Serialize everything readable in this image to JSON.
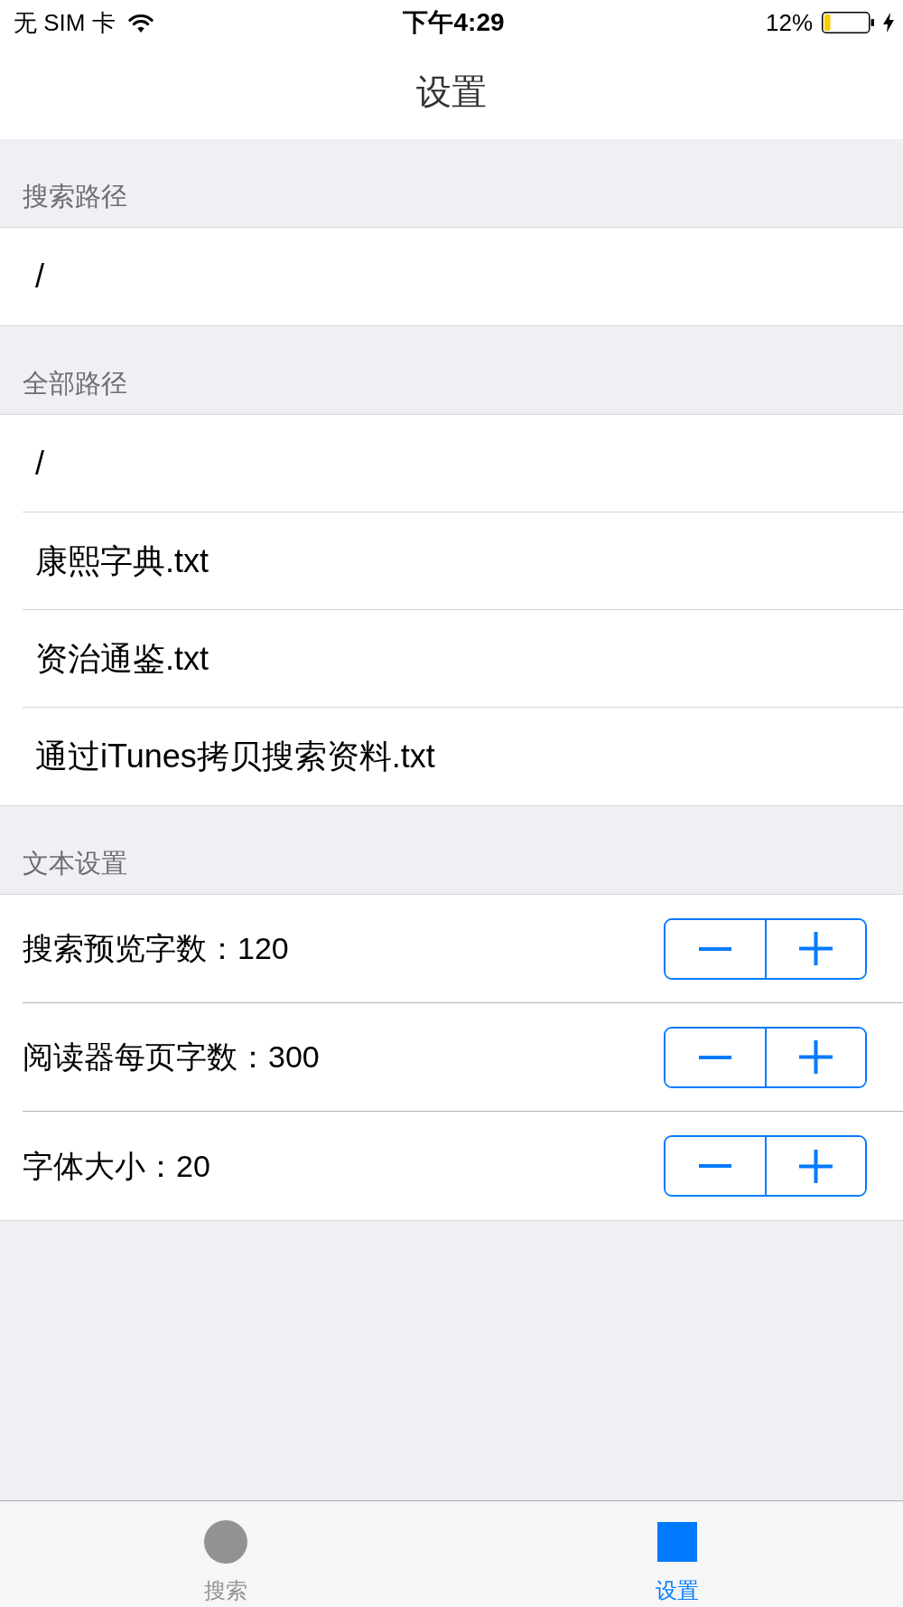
{
  "status_bar": {
    "carrier": "无 SIM 卡",
    "time": "下午4:29",
    "battery": "12%"
  },
  "nav_bar": {
    "title": "设置"
  },
  "sections": [
    {
      "header": "搜索路径",
      "rows": [
        {
          "kind": "path",
          "label": "/"
        }
      ]
    },
    {
      "header": "全部路径",
      "rows": [
        {
          "kind": "path",
          "label": "/"
        },
        {
          "kind": "path",
          "label": "康熙字典.txt"
        },
        {
          "kind": "path",
          "label": "资治通鉴.txt"
        },
        {
          "kind": "path",
          "label": "通过iTunes拷贝搜索资料.txt"
        }
      ]
    },
    {
      "header": "文本设置",
      "rows": [
        {
          "kind": "stepper",
          "label": "搜索预览字数：120"
        },
        {
          "kind": "stepper",
          "label": "阅读器每页字数：300"
        },
        {
          "kind": "stepper",
          "label": "字体大小：20"
        }
      ]
    }
  ],
  "tab_bar": {
    "items": [
      {
        "label": "搜索",
        "selected": false
      },
      {
        "label": "设置",
        "selected": true
      }
    ]
  }
}
